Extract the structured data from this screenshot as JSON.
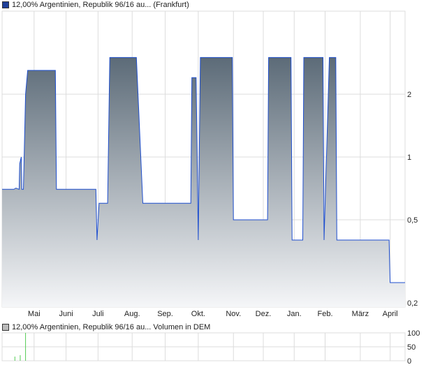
{
  "colors": {
    "line": "#1f4fcf",
    "fill_top": "#5c6b78",
    "fill_bottom": "#f5f6f8",
    "grid": "#dcdcdc",
    "volume": "#55cc55",
    "legend_main": "#1f3f99",
    "legend_vol": "#bbbbbb"
  },
  "chart_data": [
    {
      "type": "area",
      "title": "12,00% Argentinien, Republik 96/16 au... (Frankfurt)",
      "yscale": "log",
      "ylim": [
        0.18,
        4.2
      ],
      "xlim": [
        0,
        378
      ],
      "y_ticks": [
        {
          "v": 2,
          "label": "2"
        },
        {
          "v": 1,
          "label": "1"
        },
        {
          "v": 0.5,
          "label": "0,5"
        },
        {
          "v": 0.2,
          "label": "0,2"
        }
      ],
      "x_ticks": [
        {
          "d": 30,
          "label": "Mai"
        },
        {
          "d": 60,
          "label": "Juni"
        },
        {
          "d": 90,
          "label": "Juli"
        },
        {
          "d": 122,
          "label": "Aug."
        },
        {
          "d": 153,
          "label": "Sep."
        },
        {
          "d": 184,
          "label": "Okt."
        },
        {
          "d": 217,
          "label": "Nov."
        },
        {
          "d": 245,
          "label": "Dez."
        },
        {
          "d": 274,
          "label": "Jan."
        },
        {
          "d": 303,
          "label": "Feb."
        },
        {
          "d": 336,
          "label": "März"
        },
        {
          "d": 364,
          "label": "April"
        }
      ],
      "x": [
        0,
        11,
        13,
        16,
        16.5,
        18,
        18.5,
        20,
        22,
        24,
        50,
        51,
        88,
        89,
        91,
        99,
        101,
        126,
        132,
        177,
        178,
        182,
        184,
        186,
        216,
        217,
        249,
        250,
        271,
        272,
        282,
        283,
        301,
        302,
        307,
        313,
        314,
        363,
        364,
        378
      ],
      "y": [
        0.7,
        0.7,
        0.71,
        0.7,
        0.93,
        1.0,
        0.7,
        0.7,
        2.0,
        2.6,
        2.6,
        0.7,
        0.7,
        0.4,
        0.6,
        0.6,
        3.0,
        3.0,
        0.6,
        0.6,
        2.4,
        2.4,
        0.4,
        3.0,
        3.0,
        0.5,
        0.5,
        3.0,
        3.0,
        0.4,
        0.4,
        3.0,
        3.0,
        0.4,
        3.0,
        3.0,
        0.4,
        0.4,
        0.25,
        0.25
      ]
    },
    {
      "type": "bar",
      "title": "12,00% Argentinien, Republik 96/16 au... Volumen in DEM",
      "ylim": [
        0,
        100
      ],
      "y_ticks": [
        {
          "v": 100,
          "label": "100"
        },
        {
          "v": 50,
          "label": "50"
        },
        {
          "v": 0,
          "label": "0"
        }
      ],
      "x": [
        12,
        17,
        22
      ],
      "values": [
        15,
        20,
        100
      ]
    }
  ]
}
